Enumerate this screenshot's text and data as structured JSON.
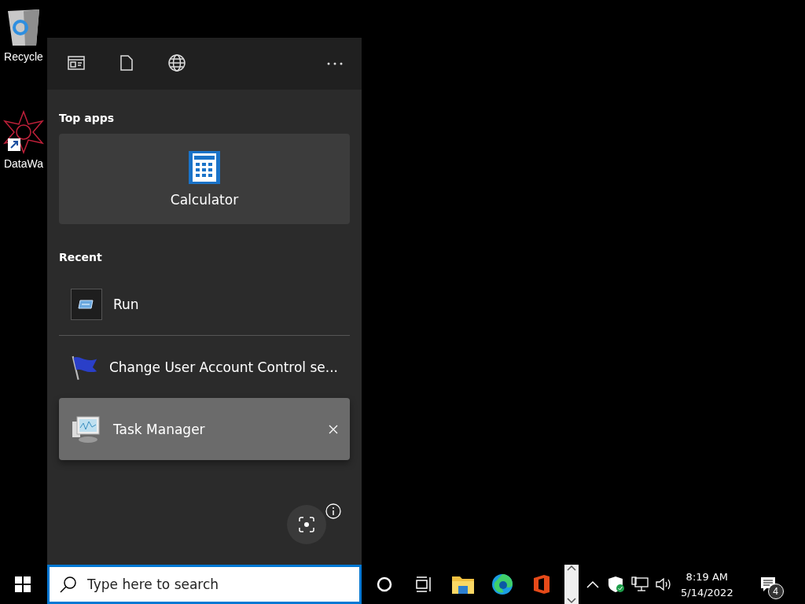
{
  "desktop_icons": [
    {
      "label": "Recycle",
      "kind": "recycle"
    },
    {
      "label": "DataWa",
      "kind": "shortcut"
    }
  ],
  "search_panel": {
    "tabs": [
      {
        "kind": "apps",
        "selected": false
      },
      {
        "kind": "documents",
        "selected": false
      },
      {
        "kind": "web",
        "selected": false
      }
    ],
    "top_apps": {
      "heading": "Top apps",
      "items": [
        {
          "label": "Calculator"
        }
      ]
    },
    "recent": {
      "heading": "Recent",
      "items": [
        {
          "label": "Run",
          "kind": "run",
          "selected": false
        },
        {
          "label": "Change User Account Control se...",
          "kind": "flag",
          "selected": false
        },
        {
          "label": "Task Manager",
          "kind": "taskmanager",
          "selected": true
        }
      ]
    }
  },
  "taskbar": {
    "search": {
      "placeholder": "Type here to search"
    },
    "apps": [
      {
        "kind": "cortana"
      },
      {
        "kind": "taskview"
      },
      {
        "kind": "explorer"
      },
      {
        "kind": "edge"
      },
      {
        "kind": "office"
      }
    ],
    "tray": [
      {
        "kind": "security"
      },
      {
        "kind": "network"
      },
      {
        "kind": "volume"
      }
    ],
    "clock": {
      "time": "8:19 AM",
      "date": "5/14/2022"
    },
    "notifications": {
      "count": "4"
    }
  }
}
